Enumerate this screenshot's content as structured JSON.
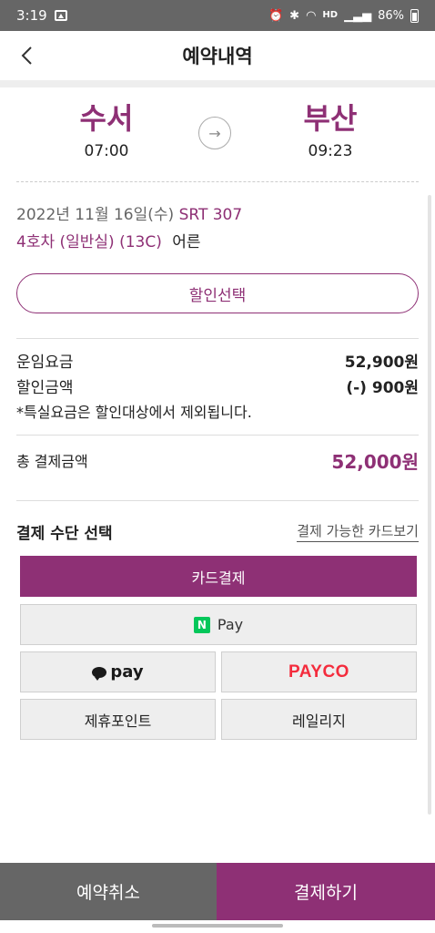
{
  "status_bar": {
    "time": "3:19",
    "battery": "86%",
    "hd_label": "HD"
  },
  "header": {
    "title": "예약내역"
  },
  "route": {
    "departure_station": "수서",
    "departure_time": "07:00",
    "arrival_station": "부산",
    "arrival_time": "09:23",
    "arrow": "→"
  },
  "trip": {
    "date": "2022년 11월 16일(수)",
    "train": "SRT 307",
    "car_seat": "4호차 (일반실) (13C)",
    "passenger": "어른"
  },
  "discount_button": "할인선택",
  "fare": {
    "base_label": "운임요금",
    "base_value": "52,900원",
    "discount_label": "할인금액",
    "discount_value": "(-) 900원",
    "note": "*특실요금은 할인대상에서 제외됩니다."
  },
  "total": {
    "label": "총 결제금액",
    "value": "52,000원"
  },
  "payment": {
    "heading": "결제 수단 선택",
    "card_link": "결제 가능한 카드보기",
    "card_pay": "카드결제",
    "npay_n": "N",
    "npay_label": "Pay",
    "kakaopay": "pay",
    "payco": "PAYCO",
    "partner_points": "제휴포인트",
    "mileage": "레일리지"
  },
  "bottom": {
    "cancel": "예약취소",
    "pay": "결제하기"
  },
  "colors": {
    "brand": "#8e3075",
    "gray_button": "#666666",
    "payco": "#f42c3d",
    "npay": "#03c75a"
  }
}
